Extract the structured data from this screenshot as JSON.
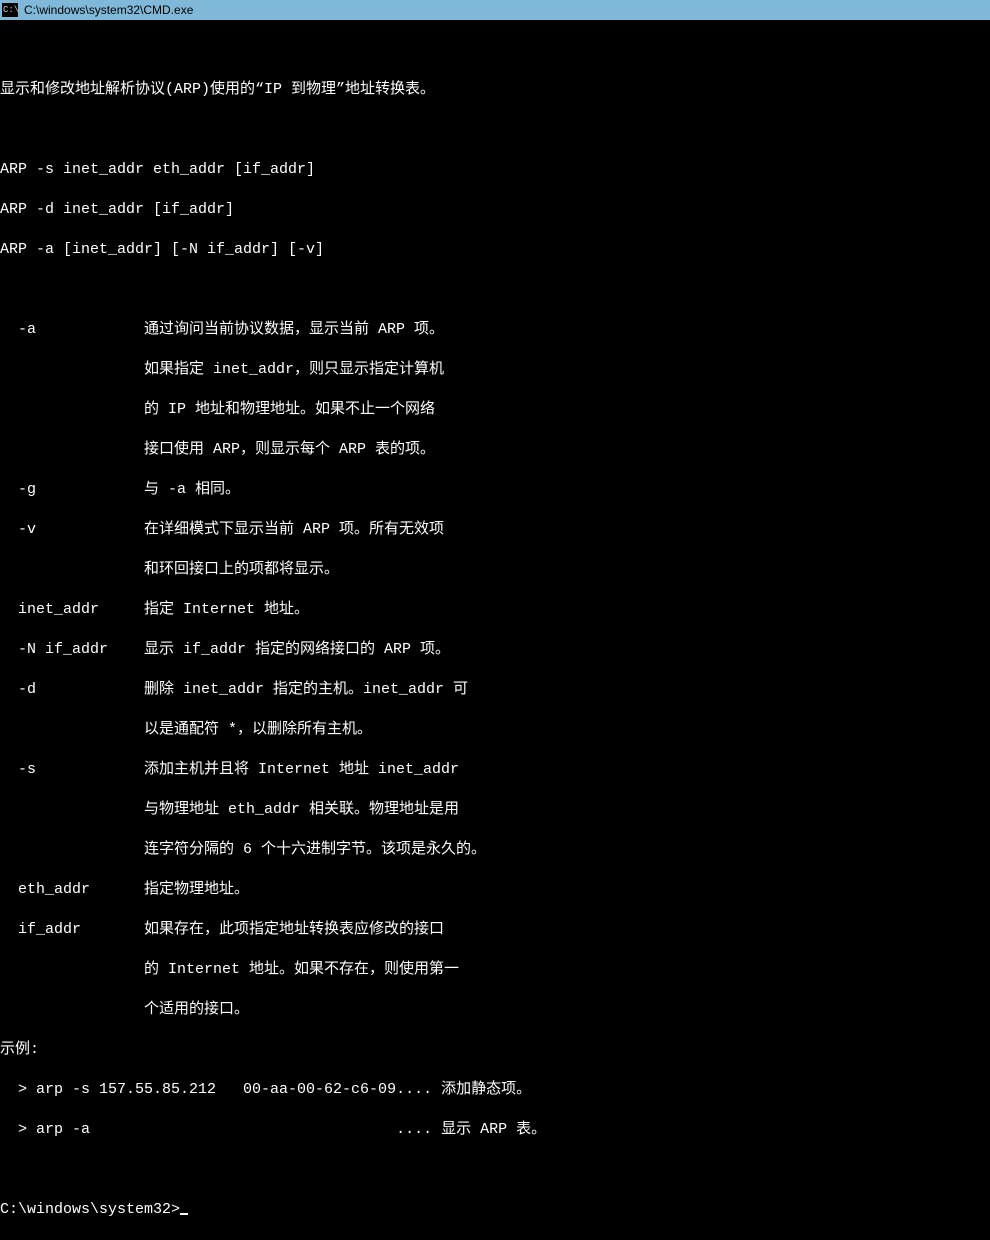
{
  "title": "C:\\windows\\system32\\CMD.exe",
  "icon_text": "C:\\",
  "lines": {
    "desc": "显示和修改地址解析协议(ARP)使用的“IP 到物理”地址转换表。",
    "usage1": "ARP -s inet_addr eth_addr [if_addr]",
    "usage2": "ARP -d inet_addr [if_addr]",
    "usage3": "ARP -a [inet_addr] [-N if_addr] [-v]",
    "a1": "  -a            通过询问当前协议数据，显示当前 ARP 项。",
    "a2": "                如果指定 inet_addr，则只显示指定计算机",
    "a3": "                的 IP 地址和物理地址。如果不止一个网络",
    "a4": "                接口使用 ARP，则显示每个 ARP 表的项。",
    "g1": "  -g            与 -a 相同。",
    "v1": "  -v            在详细模式下显示当前 ARP 项。所有无效项",
    "v2": "                和环回接口上的项都将显示。",
    "in1": "  inet_addr     指定 Internet 地址。",
    "n1": "  -N if_addr    显示 if_addr 指定的网络接口的 ARP 项。",
    "d1": "  -d            删除 inet_addr 指定的主机。inet_addr 可",
    "d2": "                以是通配符 *，以删除所有主机。",
    "s1": "  -s            添加主机并且将 Internet 地址 inet_addr",
    "s2": "                与物理地址 eth_addr 相关联。物理地址是用",
    "s3": "                连字符分隔的 6 个十六进制字节。该项是永久的。",
    "e1": "  eth_addr      指定物理地址。",
    "if1": "  if_addr       如果存在，此项指定地址转换表应修改的接口",
    "if2": "                的 Internet 地址。如果不存在，则使用第一",
    "if3": "                个适用的接口。",
    "ex0": "示例:",
    "ex1": "  > arp -s 157.55.85.212   00-aa-00-62-c6-09.... 添加静态项。",
    "ex2": "  > arp -a                                  .... 显示 ARP 表。",
    "prompt": "C:\\windows\\system32>"
  }
}
